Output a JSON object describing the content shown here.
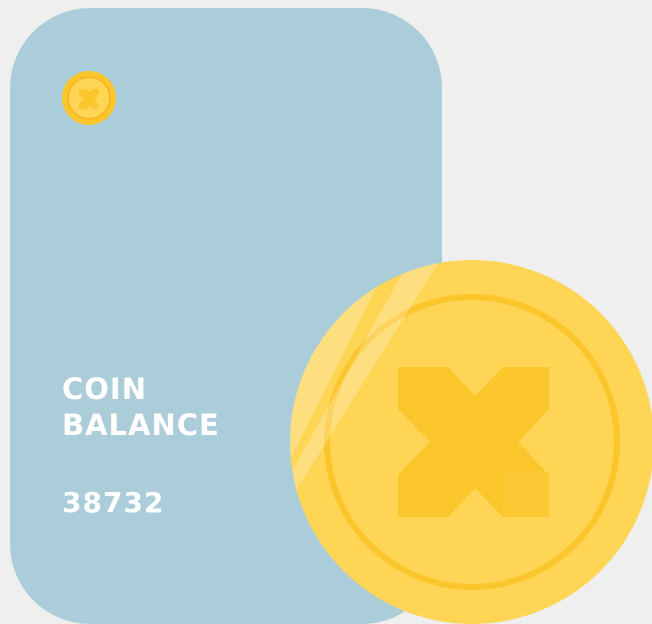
{
  "card": {
    "title_line1": "COIN",
    "title_line2": "BALANCE",
    "balance": "38732"
  },
  "icons": {
    "small_logo": "x-coin-icon",
    "large_coin": "x-coin-icon"
  },
  "colors": {
    "background": "#efefef",
    "card": "#abcdd9",
    "coin": "#fed554",
    "coin_ring": "#fbc52c",
    "coin_mark": "#fbc52c",
    "text": "#ffffff"
  }
}
